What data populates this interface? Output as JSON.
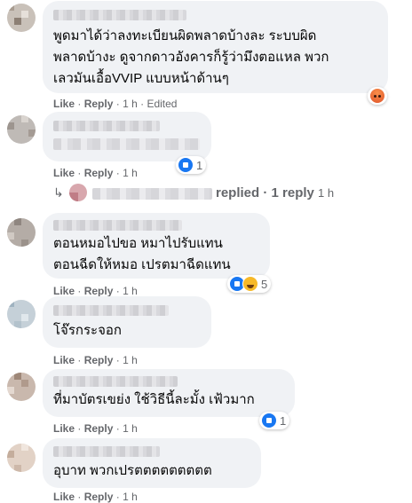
{
  "comments": [
    {
      "text_lines": [
        "พูดมาได้ว่าลงทะเบียนผิดพลาดบ้างละ ระบบผิด",
        "พลาดบ้างะ ดูจากดาวอังคารก็รู้ว่ามึงตอแหล พวก",
        "เลวมันเอื้อVVIP แบบหน้าด้านๆ"
      ],
      "actions": {
        "like": "Like",
        "sep": "·",
        "reply": "Reply",
        "time": "1 h",
        "edited": "Edited"
      },
      "reaction": {
        "icons": [
          "angry-icon"
        ],
        "count": ""
      }
    },
    {
      "text_lines": [],
      "actions": {
        "like": "Like",
        "sep": "·",
        "reply": "Reply",
        "time": "1 h",
        "edited": ""
      },
      "reaction": {
        "icons": [
          "like-icon"
        ],
        "count": "1"
      }
    },
    {
      "text_lines": [
        "ตอนหมอไปขอ หมาไปรับแทน",
        "ตอนฉีดให้หมอ เปรตมาฉีดแทน"
      ],
      "actions": {
        "like": "Like",
        "sep": "·",
        "reply": "Reply",
        "time": "1 h",
        "edited": ""
      },
      "reaction": {
        "icons": [
          "like-icon",
          "haha-icon"
        ],
        "count": "5"
      }
    },
    {
      "text_lines": [
        "โจ๊รกระจอก"
      ],
      "actions": {
        "like": "Like",
        "sep": "·",
        "reply": "Reply",
        "time": "1 h",
        "edited": ""
      },
      "reaction": null
    },
    {
      "text_lines": [
        "ที่มาบัตรเขย่ง ใช้วิธีนี้ละมั้ง เฟ้วมาก"
      ],
      "actions": {
        "like": "Like",
        "sep": "·",
        "reply": "Reply",
        "time": "1 h",
        "edited": ""
      },
      "reaction": {
        "icons": [
          "like-icon"
        ],
        "count": "1"
      }
    },
    {
      "text_lines": [
        "อุบาท พวกเปรตตตตตตตตต"
      ],
      "actions": {
        "like": "Like",
        "sep": "·",
        "reply": "Reply",
        "time": "1 h",
        "edited": ""
      },
      "reaction": null
    }
  ],
  "reply_summary": {
    "label": "replied · 1 reply",
    "time": "1 h",
    "arrow_icon": "reply-arrow-icon"
  },
  "colors": {
    "bubble": "#f0f2f5",
    "meta": "#65676b",
    "like_blue": "#1877f2"
  }
}
